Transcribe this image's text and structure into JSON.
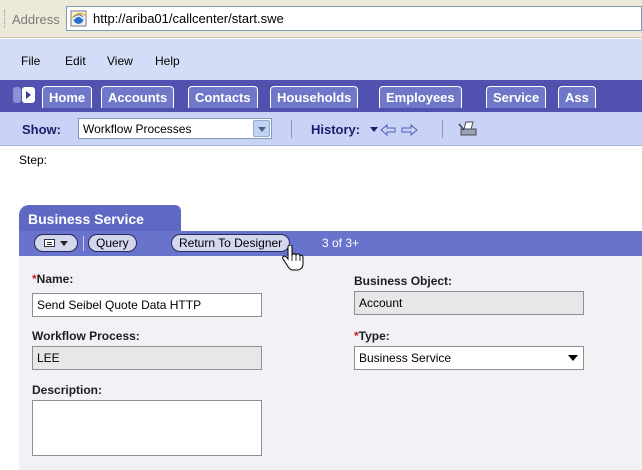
{
  "address_bar": {
    "label": "Address",
    "url": "http://ariba01/callcenter/start.swe"
  },
  "menu": [
    "File",
    "Edit",
    "View",
    "Help"
  ],
  "tabs": [
    "Home",
    "Accounts",
    "Contacts",
    "Households",
    "Employees",
    "Service",
    "Ass"
  ],
  "toolbar": {
    "show_label": "Show:",
    "show_value": "Workflow Processes",
    "history_label": "History:"
  },
  "step_label": "Step:",
  "applet": {
    "title": "Business Service",
    "query_button": "Query",
    "return_button": "Return To Designer",
    "record_count": "3 of 3+"
  },
  "form": {
    "name_label": "Name:",
    "name_value": "Send Seibel Quote Data HTTP",
    "business_object_label": "Business Object:",
    "business_object_value": "Account",
    "workflow_process_label": "Workflow Process:",
    "workflow_process_value": "LEE",
    "type_label": "Type:",
    "type_value": "Business Service",
    "description_label": "Description:",
    "description_value": ""
  },
  "required_marker": "*"
}
